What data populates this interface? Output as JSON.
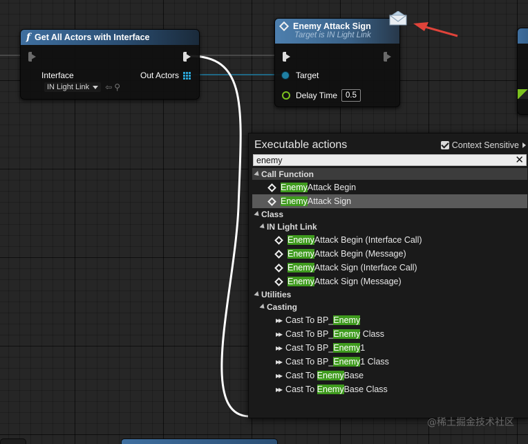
{
  "node_get_all": {
    "title": "Get All Actors with Interface",
    "interface_label": "Interface",
    "interface_value": "IN Light Link",
    "out_label": "Out Actors"
  },
  "node_attack_sign": {
    "title": "Enemy Attack Sign",
    "subtitle": "Target is IN Light Link",
    "target_label": "Target",
    "delay_label": "Delay Time",
    "delay_value": "0.5"
  },
  "menu": {
    "title": "Executable actions",
    "context_label": "Context Sensitive",
    "search_value": "enemy",
    "categories": {
      "call_function": "Call Function",
      "class": "Class",
      "in_light_link": "IN Light Link",
      "utilities": "Utilities",
      "casting": "Casting"
    },
    "call_function_items": [
      {
        "match": "Enemy",
        "rest": " Attack Begin"
      },
      {
        "match": "Enemy",
        "rest": " Attack Sign"
      }
    ],
    "class_items": [
      {
        "match": "Enemy",
        "rest": " Attack Begin (Interface Call)"
      },
      {
        "match": "Enemy",
        "rest": " Attack Begin (Message)"
      },
      {
        "match": "Enemy",
        "rest": " Attack Sign (Interface Call)"
      },
      {
        "match": "Enemy",
        "rest": " Attack Sign (Message)"
      }
    ],
    "casting_items": [
      {
        "pre": "Cast To BP_",
        "match": "Enemy",
        "rest": ""
      },
      {
        "pre": "Cast To BP_",
        "match": "Enemy",
        "rest": " Class"
      },
      {
        "pre": "Cast To BP_",
        "match": "Enemy",
        "rest": "1"
      },
      {
        "pre": "Cast To BP_",
        "match": "Enemy",
        "rest": "1 Class"
      },
      {
        "pre": "Cast To ",
        "match": "Enemy",
        "rest": "Base"
      },
      {
        "pre": "Cast To ",
        "match": "Enemy",
        "rest": "Base Class"
      }
    ]
  },
  "watermark": "@稀土掘金技术社区",
  "colors": {
    "canvas": "#262626",
    "node_header": "#3f6f9f",
    "highlight": "#3f9b1e",
    "arrow": "#e0433a",
    "wire": "#ffffff"
  }
}
